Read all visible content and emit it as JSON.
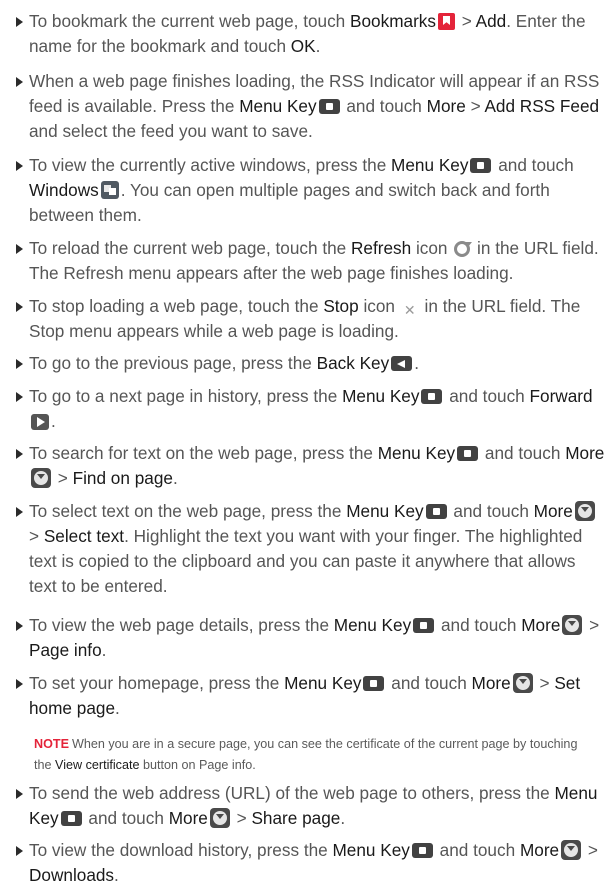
{
  "items": [
    {
      "id": "bookmark",
      "t0": "To bookmark the current web page, touch ",
      "k0": "Bookmarks",
      "icon0": "bookmark-icon",
      "t1": " > ",
      "k1": "Add",
      "t2": ". Enter the name for the bookmark and touch ",
      "k2": "OK",
      "t3": "."
    },
    {
      "id": "rss",
      "t0": "When a web page finishes loading, the RSS Indicator will appear if an RSS feed is available. Press the ",
      "k0": "Menu Key",
      "icon0": "menu-key-icon",
      "t1": " and touch ",
      "k1": "More",
      "t2": " > ",
      "k2": "Add RSS Feed",
      "t3": " and select the feed you want to save."
    },
    {
      "id": "windows",
      "t0": "To view the currently active windows, press the ",
      "k0": "Menu Key",
      "icon0": "menu-key-icon",
      "t1": " and touch ",
      "k1": "Windows",
      "icon1": "windows-icon",
      "t2": ". You can open multiple pages and switch back and forth between them."
    },
    {
      "id": "refresh",
      "t0": "To reload the current web page, touch the ",
      "k0": "Refresh",
      "t1": " icon ",
      "icon0": "refresh-icon",
      "t2": " in the URL field. The Refresh menu appears after the web page finishes loading."
    },
    {
      "id": "stop",
      "t0": "To stop loading a web page, touch the ",
      "k0": "Stop",
      "t1": " icon ",
      "icon0": "stop-icon",
      "t2": " in the URL field. The Stop menu appears while a web page is loading."
    },
    {
      "id": "back",
      "t0": "To go to the previous page, press the ",
      "k0": "Back Key",
      "icon0": "back-key-icon",
      "t1": "."
    },
    {
      "id": "forward",
      "t0": "To go to a next page in history, press the ",
      "k0": "Menu Key",
      "icon0": "menu-key-icon",
      "t1": " and touch ",
      "k1": "Forward",
      "icon1": "forward-icon",
      "t2": "."
    },
    {
      "id": "find",
      "t0": "To search for text on the web page, press the ",
      "k0": "Menu Key",
      "icon0": "menu-key-icon",
      "t1": " and touch ",
      "k1": "More",
      "icon1": "more-icon",
      "t2": " > ",
      "k2": "Find on page",
      "t3": "."
    },
    {
      "id": "select",
      "t0": "To select text on the web page, press the ",
      "k0": "Menu Key",
      "icon0": "menu-key-icon",
      "t1": " and touch ",
      "k1": "More",
      "icon1": "more-icon",
      "t2": " > ",
      "k2": "Select text",
      "t3": ". Highlight the text you want with your finger. The highlighted text is copied to the clipboard and you can paste it anywhere that allows text to be entered."
    },
    {
      "id": "pageinfo",
      "t0": "To view the web page details, press the ",
      "k0": "Menu Key",
      "icon0": "menu-key-icon",
      "t1": " and touch ",
      "k1": "More",
      "icon1": "more-icon",
      "t2": " > ",
      "k2": "Page info",
      "t3": "."
    },
    {
      "id": "homepage",
      "t0": "To set your homepage, press the ",
      "k0": "Menu Key",
      "icon0": "menu-key-icon",
      "t1": " and touch ",
      "k1": "More",
      "icon1": "more-icon",
      "t2": " > ",
      "k2": "Set home page",
      "t3": "."
    },
    {
      "id": "share",
      "t0": "To send the web address (URL) of the web page to others, press the ",
      "k0": "Menu Key",
      "icon0": "menu-key-icon",
      "t1": " and touch ",
      "k1": "More",
      "icon1": "more-icon",
      "t2": " > ",
      "k2": "Share page",
      "t3": "."
    },
    {
      "id": "downloads",
      "t0": "To view the download history, press the ",
      "k0": "Menu Key",
      "icon0": "menu-key-icon",
      "t1": " and touch ",
      "k1": "More",
      "icon1": "more-icon",
      "t2": " > ",
      "k2": "Downloads",
      "t3": "."
    }
  ],
  "note": {
    "label": "NOTE",
    "t0": "When you are in a secure page, you can see the certificate of the current page by touching the ",
    "k0": "View certificate",
    "t1": " button on Page info."
  },
  "colors": {
    "text": "#565656",
    "key_text": "#1a1a1a",
    "note_label": "#e4243a",
    "bullet": "#2b2b2b"
  }
}
